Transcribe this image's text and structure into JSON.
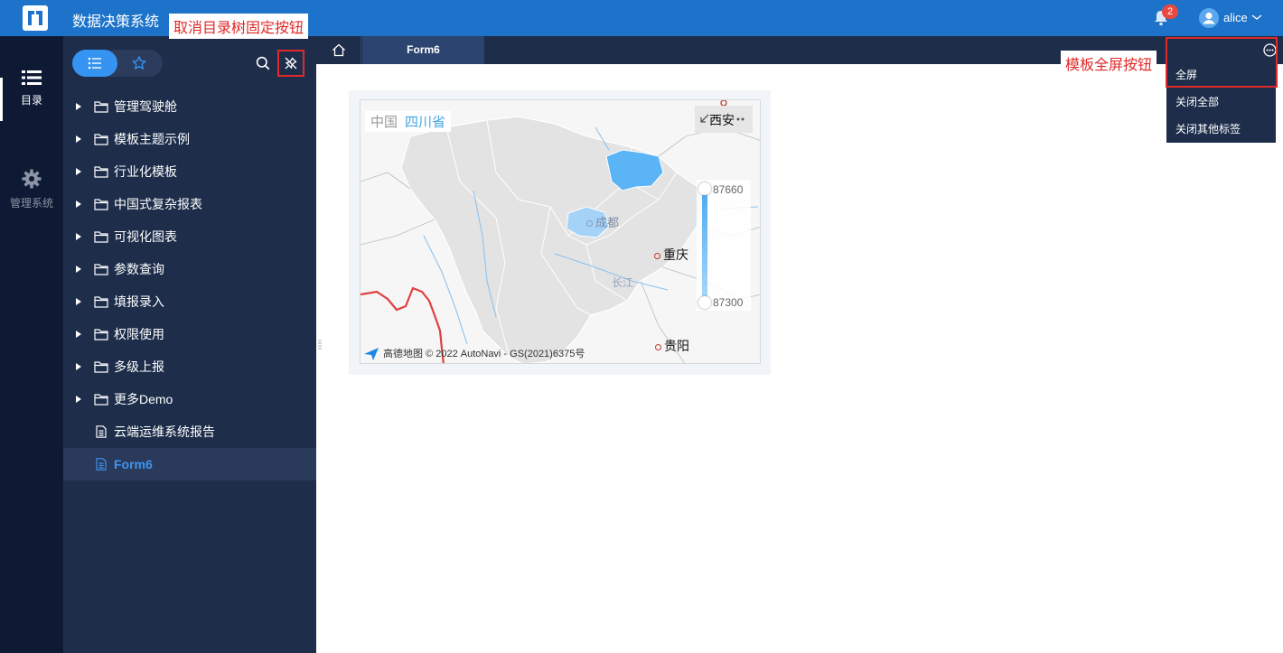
{
  "header": {
    "app_title": "数据决策系统",
    "notification_count": "2",
    "user_name": "alice",
    "brand_color": "#1c73c9"
  },
  "rail": {
    "items": [
      {
        "label": "目录",
        "icon": "list-icon",
        "active": true
      },
      {
        "label": "管理系统",
        "icon": "gear-icon",
        "active": false
      }
    ]
  },
  "directory": {
    "tree": [
      {
        "label": "管理驾驶舱",
        "type": "folder"
      },
      {
        "label": "模板主题示例",
        "type": "folder"
      },
      {
        "label": "行业化模板",
        "type": "folder"
      },
      {
        "label": "中国式复杂报表",
        "type": "folder"
      },
      {
        "label": "可视化图表",
        "type": "folder"
      },
      {
        "label": "参数查询",
        "type": "folder"
      },
      {
        "label": "填报录入",
        "type": "folder"
      },
      {
        "label": "权限使用",
        "type": "folder"
      },
      {
        "label": "多级上报",
        "type": "folder"
      },
      {
        "label": "更多Demo",
        "type": "folder"
      },
      {
        "label": "云端运维系统报告",
        "type": "file"
      },
      {
        "label": "Form6",
        "type": "file",
        "active": true
      }
    ]
  },
  "tabs": {
    "active_tab": "Form6"
  },
  "tab_menu": {
    "items": [
      "全屏",
      "关闭全部",
      "关闭其他标签"
    ]
  },
  "annotations": {
    "unpin_tree": "取消目录树固定按钮",
    "fullscreen": "模板全屏按钮"
  },
  "map": {
    "breadcrumb_country": "中国",
    "breadcrumb_province": "四川省",
    "cities": [
      "西安",
      "成都",
      "重庆",
      "长江",
      "贵阳"
    ],
    "legend_max": "87660",
    "legend_min": "87300",
    "attribution": "高德地图 © 2022 AutoNavi - GS(2021)6375号",
    "highlight_color": "#5ab4f5",
    "highlight_light_color": "#a5d3f8"
  }
}
